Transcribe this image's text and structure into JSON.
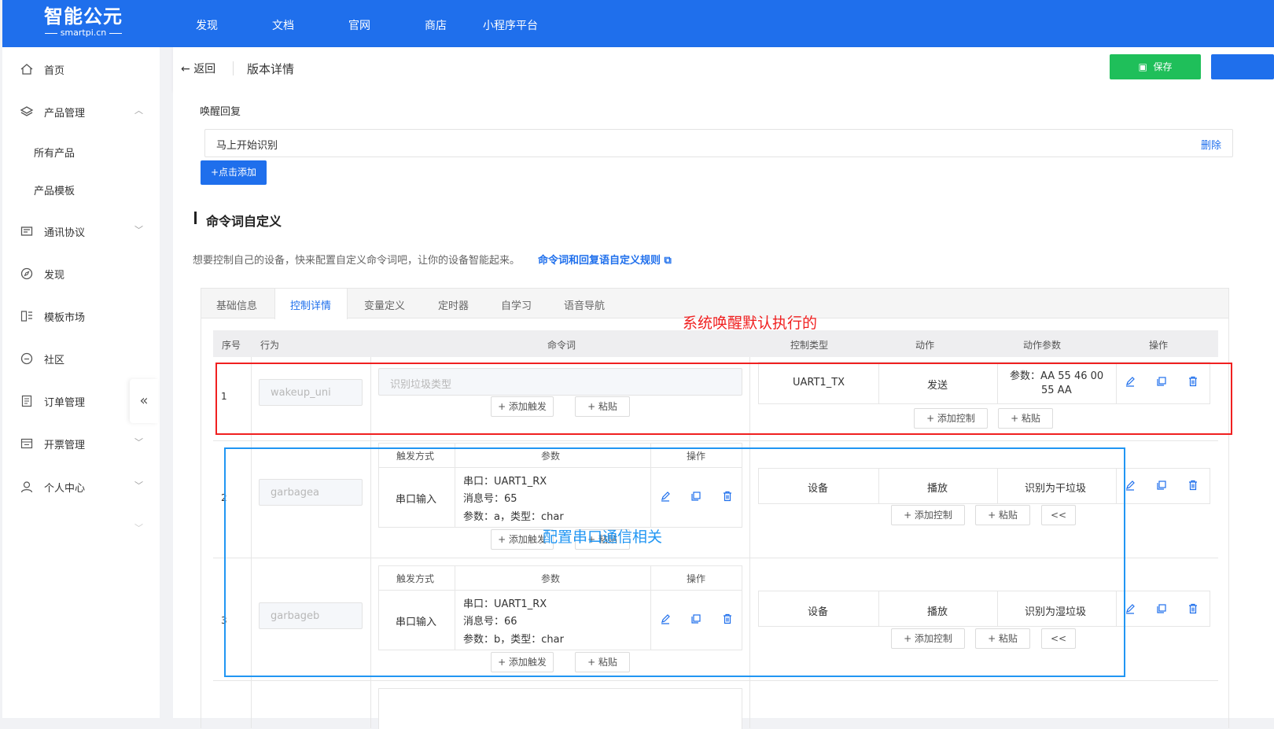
{
  "brand": {
    "name": "智能公元",
    "domain": "smartpi.cn"
  },
  "topnav": [
    "发现",
    "文档",
    "官网",
    "商店",
    "小程序平台"
  ],
  "sidebar": {
    "items": [
      {
        "label": "首页",
        "icon": "home-icon"
      },
      {
        "label": "产品管理",
        "icon": "layers-icon"
      },
      {
        "label": "所有产品"
      },
      {
        "label": "产品模板"
      },
      {
        "label": "通讯协议",
        "icon": "protocol-icon"
      },
      {
        "label": "发现",
        "icon": "compass-icon"
      },
      {
        "label": "模板市场",
        "icon": "template-icon"
      },
      {
        "label": "社区",
        "icon": "community-icon"
      },
      {
        "label": "订单管理",
        "icon": "order-icon"
      },
      {
        "label": "开票管理",
        "icon": "invoice-icon"
      },
      {
        "label": "个人中心",
        "icon": "user-icon"
      }
    ]
  },
  "header": {
    "back": "返回",
    "title": "版本详情",
    "save": "保存"
  },
  "wake": {
    "label": "唤醒回复",
    "value": "马上开始识别",
    "delete": "删除",
    "add": "+点击添加"
  },
  "section": {
    "title": "命令词自定义",
    "desc": "想要控制自己的设备，快来配置自定义命令词吧，让你的设备智能起来。",
    "link": "命令词和回复语自定义规则"
  },
  "tabs": [
    "基础信息",
    "控制详情",
    "变量定义",
    "定时器",
    "自学习",
    "语音导航"
  ],
  "table": {
    "headers": [
      "序号",
      "行为",
      "命令词",
      "控制类型",
      "动作",
      "动作参数",
      "操作"
    ],
    "sub_headers": [
      "触发方式",
      "参数",
      "操作"
    ],
    "add_trigger": "+ 添加触发",
    "paste": "+ 粘贴",
    "add_control": "+ 添加控制",
    "collapse": "<<",
    "rows": [
      {
        "index": "1",
        "behavior": "wakeup_uni",
        "command_placeholder": "识别垃圾类型",
        "control_type": "UART1_TX",
        "action": "发送",
        "param_line1": "参数：AA 55 46 00",
        "param_line2": "55 AA"
      },
      {
        "index": "2",
        "behavior": "garbagea",
        "trigger": "串口输入",
        "p1": "串口：UART1_RX",
        "p2": "消息号：65",
        "p3": "参数：a，类型：char",
        "control_type": "设备",
        "action": "播放",
        "action_param": "识别为干垃圾"
      },
      {
        "index": "3",
        "behavior": "garbageb",
        "trigger": "串口输入",
        "p1": "串口：UART1_RX",
        "p2": "消息号：66",
        "p3": "参数：b，类型：char",
        "control_type": "设备",
        "action": "播放",
        "action_param": "识别为湿垃圾"
      }
    ]
  },
  "annotations": {
    "red": "系统唤醒默认执行的",
    "blue": "配置串口通信相关"
  }
}
